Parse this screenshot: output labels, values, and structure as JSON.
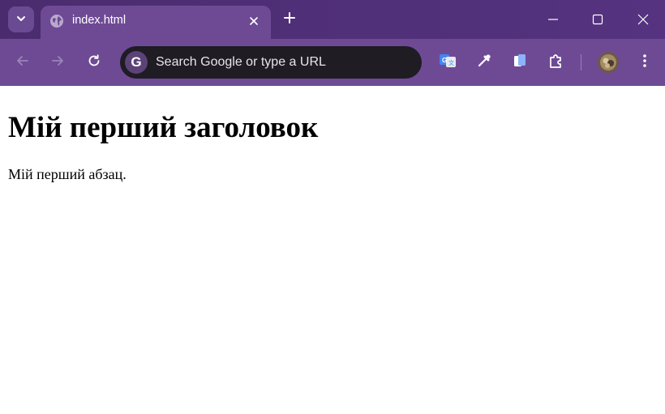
{
  "browser": {
    "tab": {
      "title": "index.html"
    },
    "omnibox": {
      "placeholder": "Search Google or type a URL",
      "badge": "G"
    },
    "colors": {
      "tabstrip": "#4f2f77",
      "toolbar": "#6e4a95",
      "omnibox": "#1f1c24"
    },
    "icons": {
      "tab_search": "chevron-down-icon",
      "favicon": "globe-icon",
      "tab_close": "close-icon",
      "new_tab": "plus-icon",
      "minimize": "minimize-icon",
      "maximize": "maximize-icon",
      "window_close": "close-icon",
      "back": "arrow-left-icon",
      "forward": "arrow-right-icon",
      "reload": "reload-icon",
      "translate": "translate-icon",
      "eyedropper": "eyedropper-icon",
      "copy": "copy-icon",
      "extensions": "puzzle-icon",
      "menu": "kebab-menu-icon"
    }
  },
  "page": {
    "heading": "Мій перший заголовок",
    "paragraph": "Мій перший абзац."
  }
}
